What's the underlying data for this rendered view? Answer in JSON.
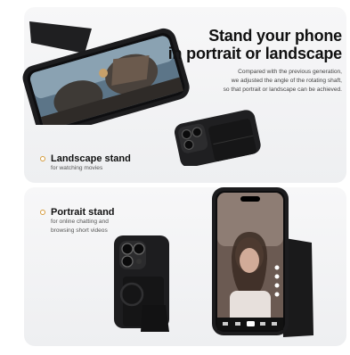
{
  "landscape_section": {
    "headline": [
      "Stand your phone",
      "in portrait or landscape"
    ],
    "description": [
      "Compared with the previous generation,",
      "we adjusted the angle of the rotating shaft,",
      "so that portrait or landscape can be achieved."
    ],
    "feature_title": "Landscape stand",
    "feature_subtitle": "for watching movies"
  },
  "portrait_section": {
    "feature_title": "Portrait stand",
    "feature_subtitle": [
      "for online chatting and",
      "browsing short videos"
    ]
  },
  "colors": {
    "accent": "#d59a3a",
    "case": "#1d1d1f",
    "card_bg": "#f2f2f4"
  },
  "icons": [
    "phone-case-icon",
    "camera-lens-icon",
    "stand-icon"
  ]
}
